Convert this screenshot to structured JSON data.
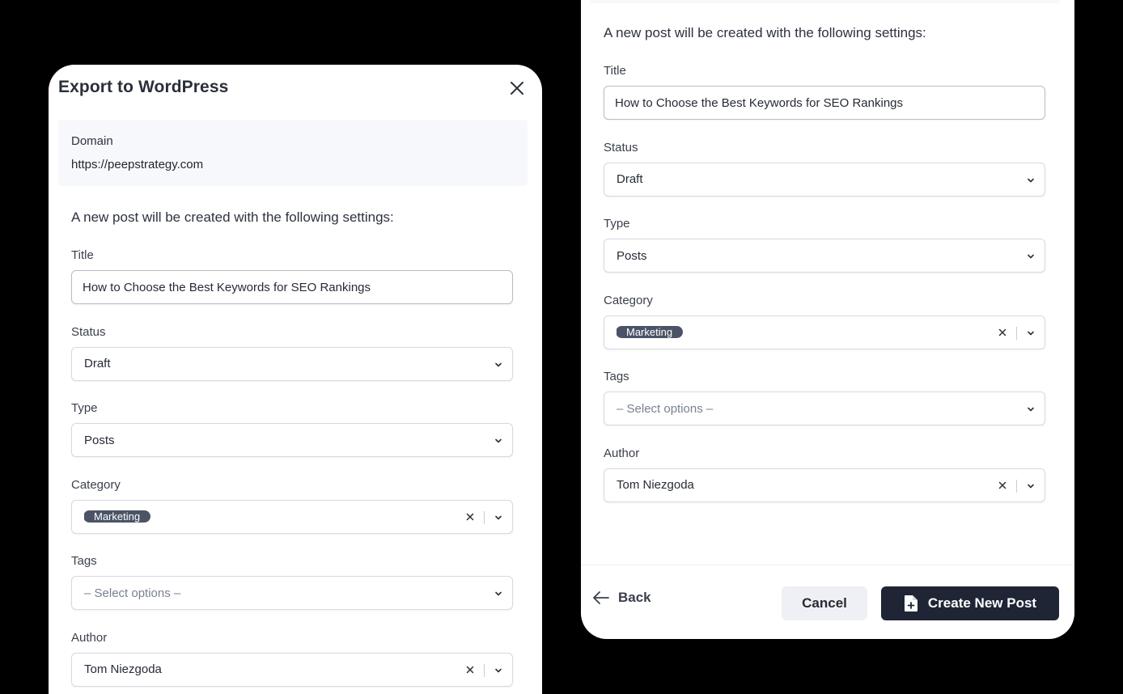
{
  "modal": {
    "title": "Export to WordPress",
    "domain_label": "Domain",
    "domain_value": "https://peepstrategy.com",
    "intro": "A new post will be created with the following settings:"
  },
  "fields": {
    "title": {
      "label": "Title",
      "value": "How to Choose the Best Keywords for SEO Rankings"
    },
    "status": {
      "label": "Status",
      "value": "Draft"
    },
    "type": {
      "label": "Type",
      "value": "Posts"
    },
    "category": {
      "label": "Category",
      "value": "Marketing"
    },
    "tags": {
      "label": "Tags",
      "placeholder": "– Select options –"
    },
    "author": {
      "label": "Author",
      "value": "Tom Niezgoda"
    }
  },
  "footer": {
    "back_label": "Back",
    "cancel_label": "Cancel",
    "create_label": "Create New Post"
  },
  "icons": {
    "close": "close-icon",
    "chevron": "chevron-down-icon",
    "clear": "clear-icon",
    "back": "arrow-left-icon",
    "create": "file-plus-icon"
  },
  "colors": {
    "backdrop": "#000000",
    "panel": "#ffffff",
    "chip": "#4b5466",
    "primary_button": "#1f2535",
    "secondary_button": "#eef0f5",
    "domain_box": "#f7f8fc"
  }
}
